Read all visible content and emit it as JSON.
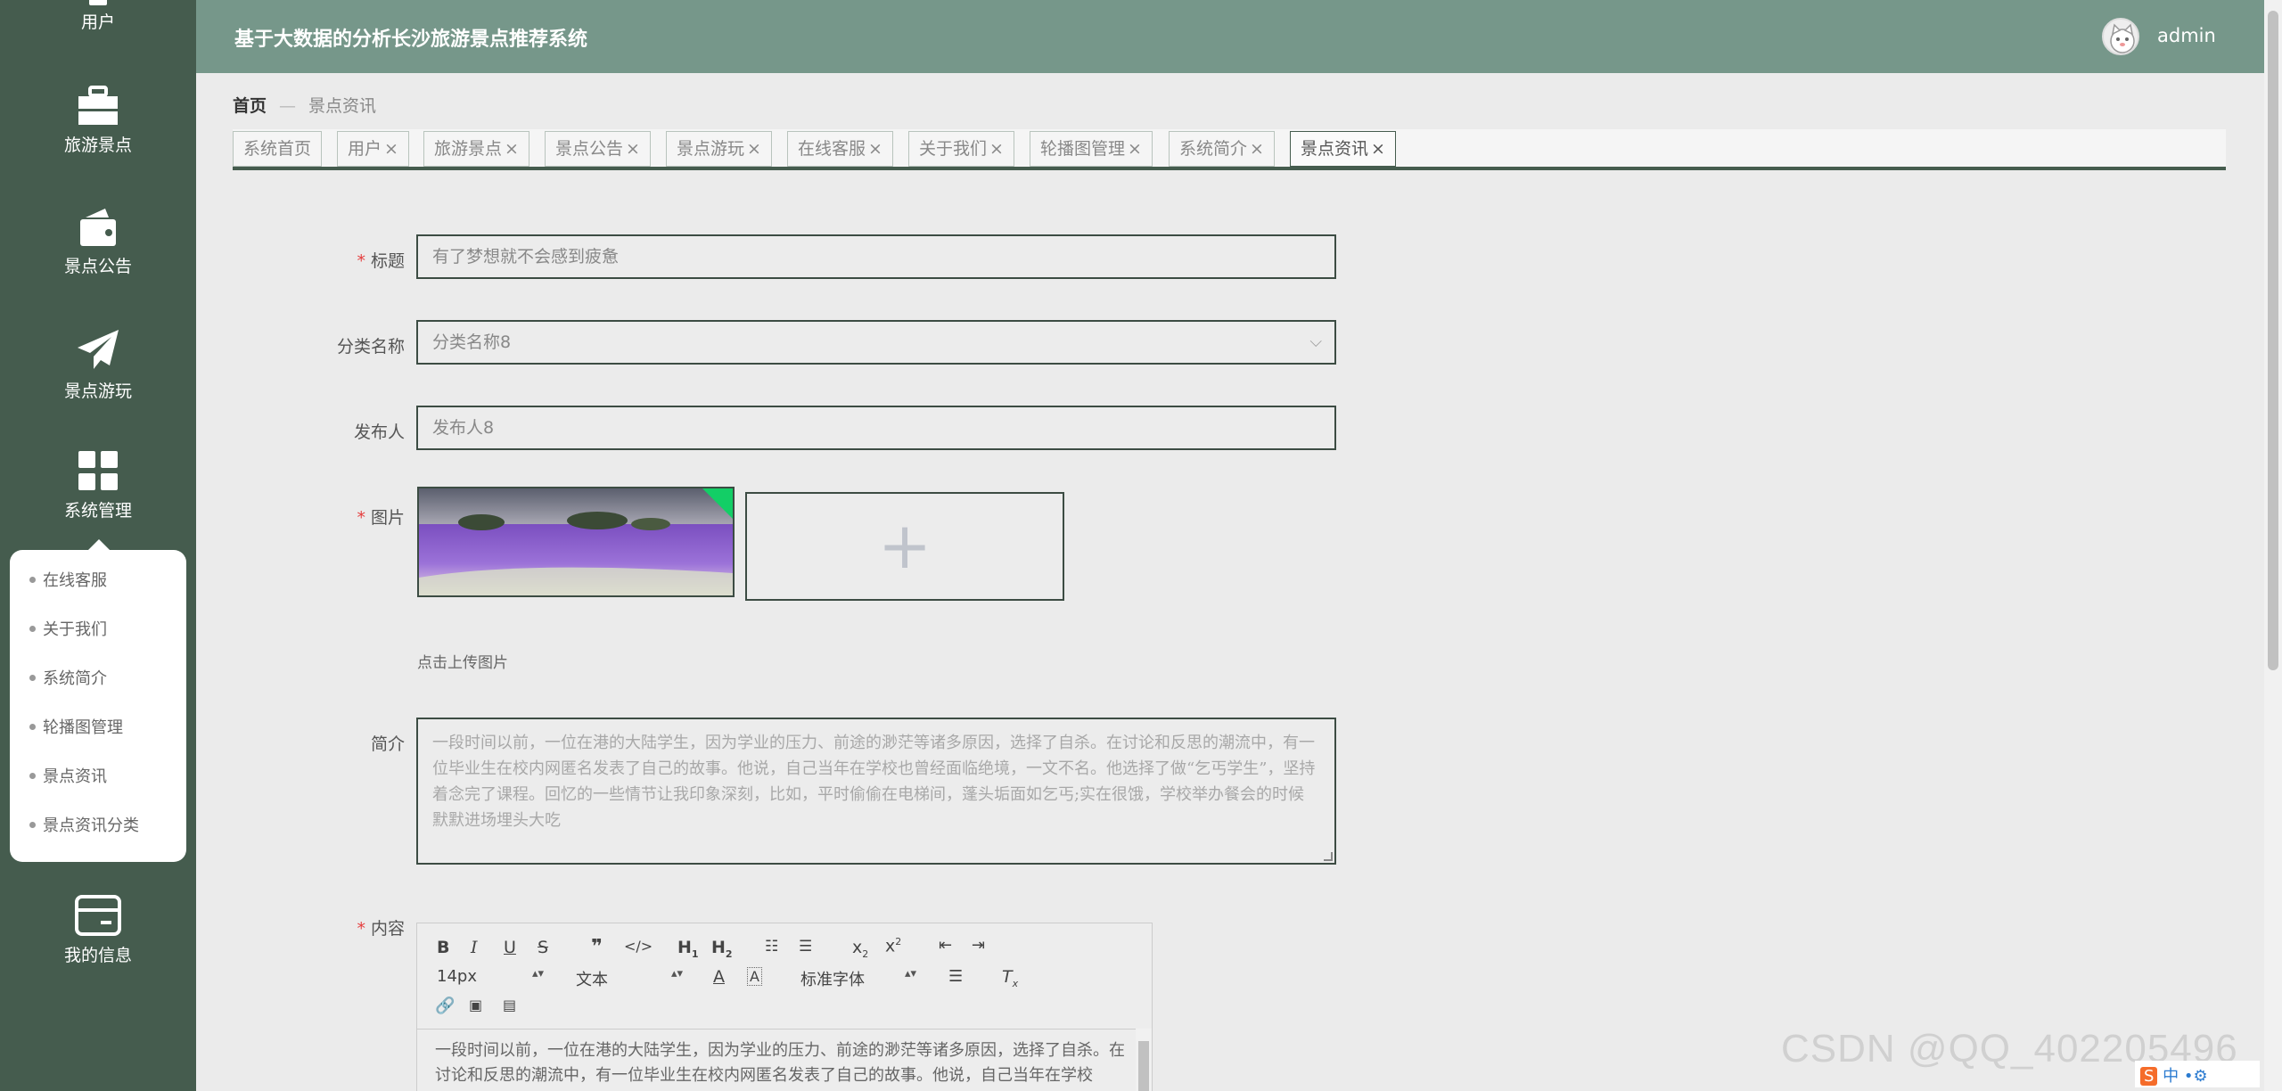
{
  "app": {
    "title": "基于大数据的分析长沙旅游景点推荐系统",
    "user": "admin"
  },
  "sidebar": {
    "items": [
      {
        "label": "用户",
        "icon": "user-icon"
      },
      {
        "label": "旅游景点",
        "icon": "briefcase-icon"
      },
      {
        "label": "景点公告",
        "icon": "wallet-icon"
      },
      {
        "label": "景点游玩",
        "icon": "paper-plane-icon"
      },
      {
        "label": "系统管理",
        "icon": "grid-icon"
      },
      {
        "label": "我的信息",
        "icon": "card-icon"
      }
    ],
    "submenu": [
      "在线客服",
      "关于我们",
      "系统简介",
      "轮播图管理",
      "景点资讯",
      "景点资讯分类"
    ]
  },
  "breadcrumb": {
    "home": "首页",
    "current": "景点资讯"
  },
  "tabs": [
    "系统首页",
    "用户",
    "旅游景点",
    "景点公告",
    "景点游玩",
    "在线客服",
    "关于我们",
    "轮播图管理",
    "系统简介",
    "景点资讯"
  ],
  "form": {
    "title_label": "标题",
    "title_value": "有了梦想就不会感到疲惫",
    "category_label": "分类名称",
    "category_value": "分类名称8",
    "publisher_label": "发布人",
    "publisher_value": "发布人8",
    "image_label": "图片",
    "upload_hint": "点击上传图片",
    "summary_label": "简介",
    "summary_value": "一段时间以前，一位在港的大陆学生，因为学业的压力、前途的渺茫等诸多原因，选择了自杀。在讨论和反思的潮流中，有一位毕业生在校内网匿名发表了自己的故事。他说，自己当年在学校也曾经面临绝境，一文不名。他选择了做“乞丐学生”，坚持着念完了课程。回忆的一些情节让我印象深刻，比如，平时偷偷在电梯间，蓬头垢面如乞丐;实在很饿，学校举办餐会的时候默默进场埋头大吃",
    "content_label": "内容",
    "content_value": "一段时间以前，一位在港的大陆学生，因为学业的压力、前途的渺茫等诸多原因，选择了自杀。在讨论和反思的潮流中，有一位毕业生在校内网匿名发表了自己的故事。他说，自己当年在学校"
  },
  "editor": {
    "font_size": "14px",
    "block_type": "文本",
    "font_family": "标准字体"
  },
  "watermark": "CSDN @QQ_402205496",
  "ime": {
    "label": "中",
    "badge": "S"
  },
  "colors": {
    "sidebar": "#455c4e",
    "header": "#76978a",
    "accent": "#13ce66",
    "required": "#e53e3e"
  }
}
